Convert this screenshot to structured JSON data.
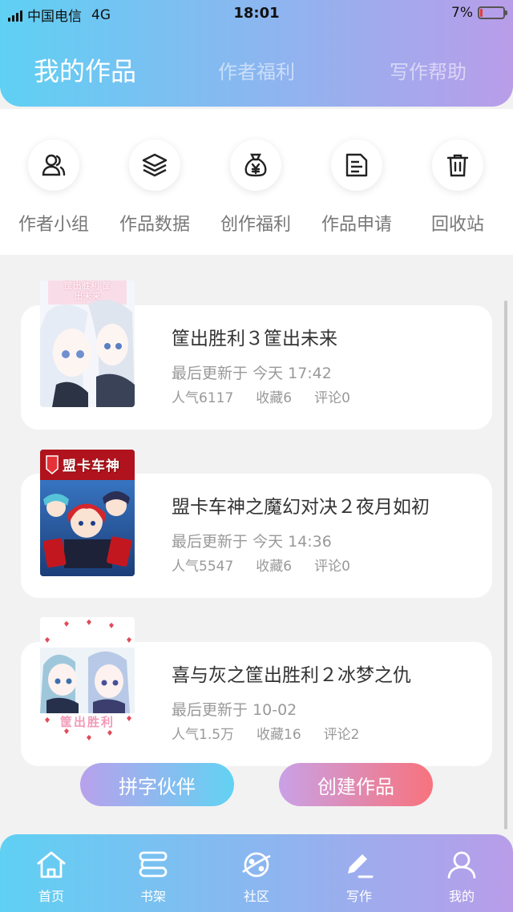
{
  "status_bar": {
    "carrier": "中国电信",
    "network": "4G",
    "time": "18:01",
    "battery": "7%",
    "battery_level": 0.07
  },
  "tabs": [
    {
      "label": "我的作品",
      "active": true
    },
    {
      "label": "作者福利",
      "active": false
    },
    {
      "label": "写作帮助",
      "active": false
    }
  ],
  "quick_actions": [
    {
      "label": "作者小组",
      "icon": "users-icon"
    },
    {
      "label": "作品数据",
      "icon": "layers-icon"
    },
    {
      "label": "创作福利",
      "icon": "money-bag-icon"
    },
    {
      "label": "作品申请",
      "icon": "document-icon"
    },
    {
      "label": "回收站",
      "icon": "trash-icon"
    }
  ],
  "works": [
    {
      "title": "筐出胜利３筐出未来",
      "updated_label": "最后更新于",
      "updated": "今天 17:42",
      "popularity": "人气6117",
      "favorites": "收藏6",
      "comments": "评论0"
    },
    {
      "title": "盟卡车神之魔幻对决２夜月如初",
      "updated_label": "最后更新于",
      "updated": "今天 14:36",
      "popularity": "人气5547",
      "favorites": "收藏6",
      "comments": "评论0"
    },
    {
      "title": "喜与灰之筐出胜利２冰梦之仇",
      "updated_label": "最后更新于",
      "updated": "10-02",
      "popularity": "人气1.5万",
      "favorites": "收藏16",
      "comments": "评论2"
    }
  ],
  "cover_texts": {
    "cover1": "筐出胜利 筐出未来",
    "cover2": "盟卡车神",
    "cover3": "筐出胜利"
  },
  "buttons": {
    "partner": "拼字伙伴",
    "create": "创建作品"
  },
  "bottom_nav": [
    {
      "label": "首页",
      "icon": "home-icon"
    },
    {
      "label": "书架",
      "icon": "bookshelf-icon"
    },
    {
      "label": "社区",
      "icon": "planet-icon"
    },
    {
      "label": "写作",
      "icon": "pen-icon",
      "active": true
    },
    {
      "label": "我的",
      "icon": "user-icon"
    }
  ],
  "colors": {
    "gradient_start": "#5fd0f3",
    "gradient_end": "#b99de9",
    "create_button_end": "#f7737d"
  }
}
